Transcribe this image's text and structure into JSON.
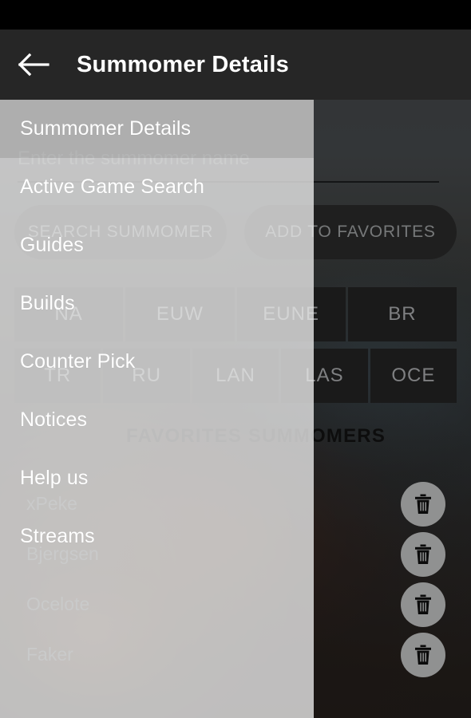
{
  "toolbar": {
    "back_icon": "arrow-left-icon",
    "title": "Summomer Details"
  },
  "content": {
    "search": {
      "placeholder": "Enter the summomer name",
      "value": ""
    },
    "buttons": {
      "search_summoner": "SEARCH SUMMOMER",
      "add_to_favorites": "ADD TO FAVORITES"
    },
    "regions_row1": [
      "NA",
      "EUW",
      "EUNE",
      "BR"
    ],
    "regions_row2": [
      "TR",
      "RU",
      "LAN",
      "LAS",
      "OCE"
    ],
    "favorites_header": "FAVORITES SUMMOMERS",
    "favorites": [
      {
        "name": "xPeke",
        "delete_icon": "trash-icon"
      },
      {
        "name": "Bjergsen",
        "delete_icon": "trash-icon"
      },
      {
        "name": "Ocelote",
        "delete_icon": "trash-icon"
      },
      {
        "name": "Faker",
        "delete_icon": "trash-icon"
      }
    ]
  },
  "drawer": {
    "items": [
      {
        "label": "Summomer Details",
        "selected": true
      },
      {
        "label": "Active Game Search",
        "selected": false
      },
      {
        "label": "Guides",
        "selected": false
      },
      {
        "label": "Builds",
        "selected": false
      },
      {
        "label": "Counter Pick",
        "selected": false
      },
      {
        "label": "Notices",
        "selected": false
      },
      {
        "label": "Help us",
        "selected": false
      },
      {
        "label": "Streams",
        "selected": false
      }
    ]
  },
  "colors": {
    "toolbar_bg": "#262626",
    "status_bar_bg": "#000000",
    "drawer_bg": "#e9e9e9",
    "region_tab_bg": "#262626",
    "pill_btn_bg": "#2d2d2d",
    "accent_text": "#ffffff"
  }
}
